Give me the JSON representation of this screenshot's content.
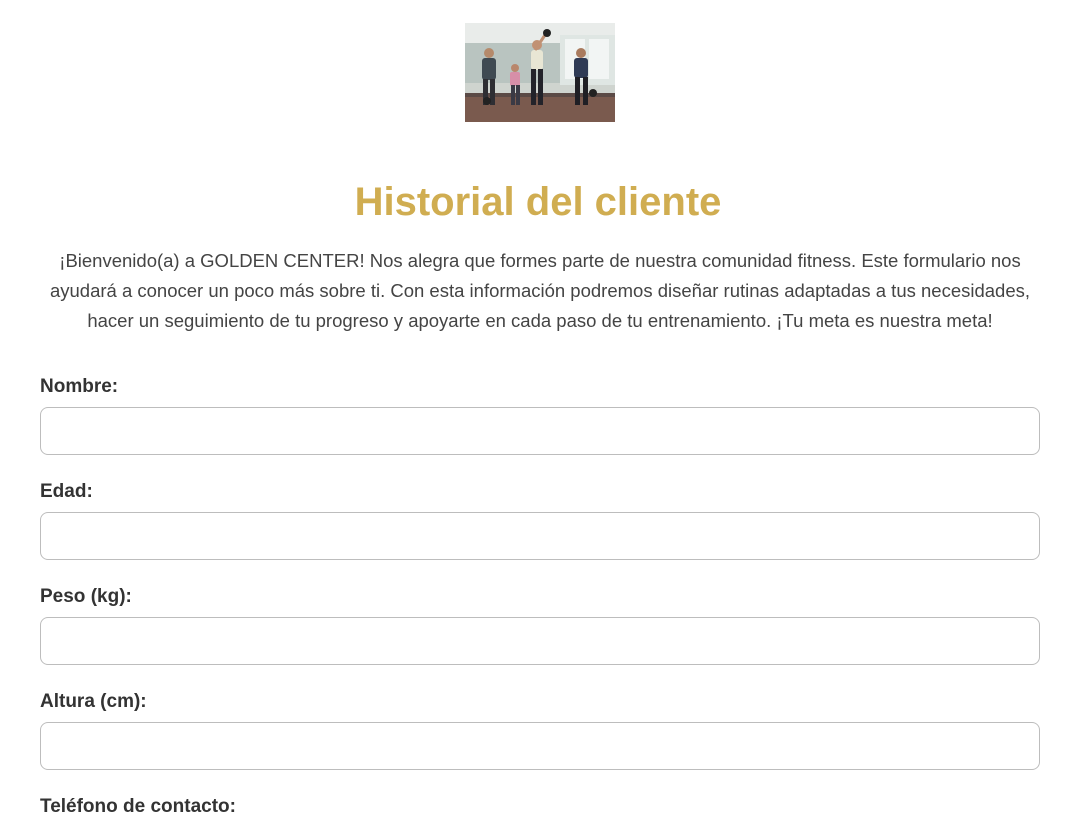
{
  "hero": {
    "image_description": "gym-kettlebell-class-photo"
  },
  "header": {
    "title": "Historial del cliente",
    "intro": "¡Bienvenido(a) a GOLDEN CENTER! Nos alegra que formes parte de nuestra comunidad fitness. Este formulario nos ayudará a conocer un poco más sobre ti. Con esta información podremos diseñar rutinas adaptadas a tus necesidades, hacer un seguimiento de tu progreso y apoyarte en cada paso de tu entrenamiento. ¡Tu meta es nuestra meta!"
  },
  "colors": {
    "accent": "#d0ad51",
    "text": "#333333",
    "input_border": "#bdbdbd"
  },
  "form": {
    "fields": [
      {
        "label": "Nombre:",
        "value": ""
      },
      {
        "label": "Edad:",
        "value": ""
      },
      {
        "label": "Peso (kg):",
        "value": ""
      },
      {
        "label": "Altura (cm):",
        "value": ""
      },
      {
        "label": "Teléfono de contacto:",
        "value": ""
      }
    ]
  }
}
